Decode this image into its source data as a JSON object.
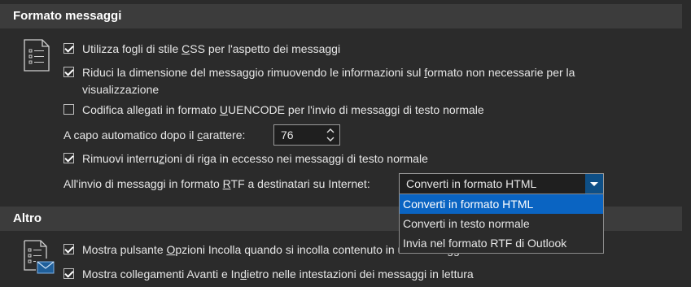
{
  "formato": {
    "header": "Formato messaggi",
    "css": {
      "pre": "Utilizza fogli di stile ",
      "u": "C",
      "post": "SS per l'aspetto dei messaggi",
      "checked": true
    },
    "riduci": {
      "pre": "Riduci la dimensione del messaggio rimuovendo le informazioni sul ",
      "u": "f",
      "post": "ormato non necessarie per la",
      "line2": "visualizzazione",
      "checked": true
    },
    "uuencode": {
      "pre": "Codifica allegati in formato ",
      "u": "U",
      "post": "UENCODE per l'invio di messaggi di testo normale",
      "checked": false
    },
    "acapo": {
      "pre": "A capo automatico dopo il ",
      "u": "c",
      "post": "arattere:",
      "value": "76"
    },
    "rimuovi": {
      "pre": "Rimuovi interru",
      "u": "z",
      "post": "ioni di riga in eccesso nei messaggi di testo normale",
      "checked": true
    },
    "rtf": {
      "pre": "All'invio di messaggi in formato ",
      "u": "R",
      "post": "TF a destinatari su Internet:",
      "selected": "Converti in formato HTML"
    },
    "rtf_options": [
      "Converti in formato HTML",
      "Converti in testo normale",
      "Invia nel formato RTF di Outlook"
    ]
  },
  "altro": {
    "header": "Altro",
    "incolla": {
      "pre": "Mostra pulsante ",
      "u": "O",
      "post": "pzioni Incolla quando si incolla contenuto in un messaggio",
      "checked": true
    },
    "avanti": {
      "pre": "Mostra collegamenti Avanti e In",
      "u": "d",
      "post": "ietro nelle intestazioni dei messaggi in lettura",
      "checked": true
    }
  },
  "colors": {
    "accent": "#0a64c2",
    "header_bg": "#3c3c3c",
    "bg": "#2b2b2b"
  },
  "icons": [
    "document-list-icon",
    "document-mail-icon",
    "checkmark-icon",
    "spin-up-icon",
    "spin-down-icon",
    "dropdown-arrow-icon"
  ]
}
